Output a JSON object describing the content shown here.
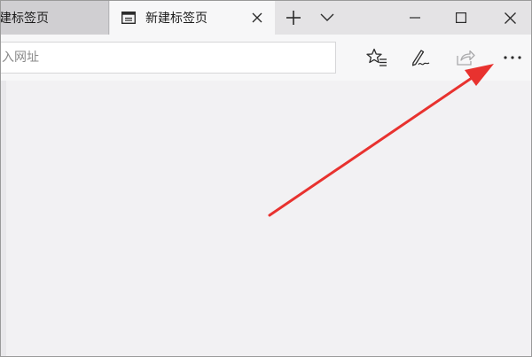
{
  "tabs": [
    {
      "label": "建标签页",
      "active": false
    },
    {
      "label": "新建标签页",
      "active": true
    }
  ],
  "address_bar": {
    "placeholder": "入网址",
    "value": ""
  },
  "icons": {
    "tab_page": "newtab-page-icon",
    "tab_close": "close-icon",
    "new_tab": "plus-icon",
    "tab_list": "chevron-down-icon",
    "minimize": "minimize-icon",
    "maximize": "maximize-icon",
    "window_close": "close-icon",
    "favorites": "star-list-icon",
    "web_note": "pen-icon",
    "share": "share-icon",
    "more": "more-icon"
  },
  "annotation": {
    "type": "red-arrow",
    "color": "#e8322f",
    "points_to": "more-button"
  },
  "colors": {
    "tabbar": "#e4e3e5",
    "active_tab": "#f7f7f8",
    "content": "#f2f1f3"
  }
}
